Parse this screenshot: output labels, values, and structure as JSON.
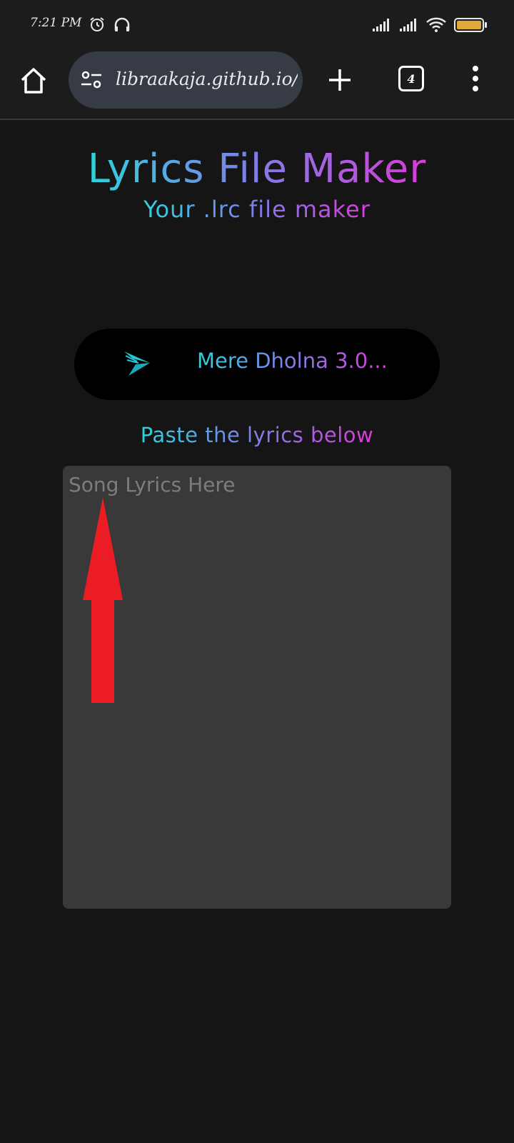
{
  "status_bar": {
    "time": "7:21 PM",
    "icons": [
      "alarm-icon",
      "headphones-icon",
      "signal-icon",
      "signal-icon",
      "wifi-icon",
      "battery-icon"
    ]
  },
  "browser": {
    "url": "libraakaja.github.io/lrc",
    "tab_count": "4",
    "icons": [
      "home-icon",
      "site-settings-icon",
      "new-tab-icon",
      "tab-switcher-icon",
      "more-menu-icon"
    ]
  },
  "page": {
    "title": "Lyrics File Maker",
    "subtitle": "Your .lrc file maker",
    "song_title": "Mere Dholna 3.0...",
    "paste_label": "Paste the lyrics below",
    "lyrics_placeholder": "Song Lyrics Here"
  },
  "colors": {
    "background": "#151515",
    "gradient_start": "#2bd4de",
    "gradient_mid": "#7f7fe8",
    "gradient_end": "#d93bd9",
    "textarea": "#393939",
    "annotation_arrow": "#ec1c24"
  }
}
